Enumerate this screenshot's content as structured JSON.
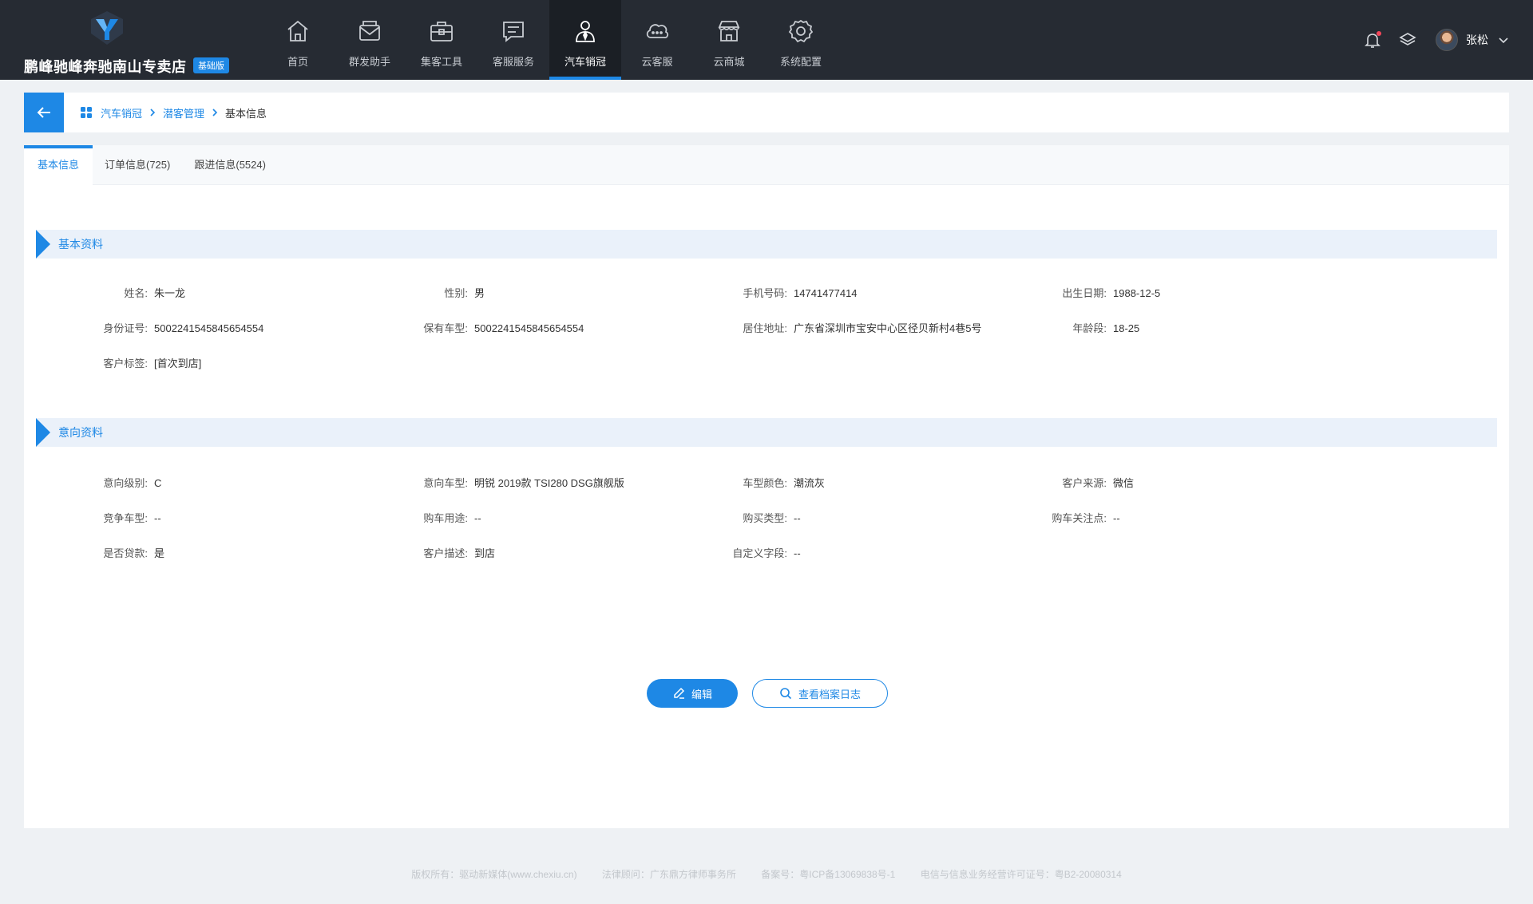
{
  "header": {
    "brand_name": "鹏峰驰峰奔驰南山专卖店",
    "brand_badge": "基础版",
    "nav": [
      {
        "label": "首页",
        "icon": "home-icon"
      },
      {
        "label": "群发助手",
        "icon": "mail-icon"
      },
      {
        "label": "集客工具",
        "icon": "briefcase-icon"
      },
      {
        "label": "客服服务",
        "icon": "message-icon"
      },
      {
        "label": "汽车销冠",
        "icon": "salesperson-icon",
        "active": true
      },
      {
        "label": "云客服",
        "icon": "cloud-chat-icon"
      },
      {
        "label": "云商城",
        "icon": "store-icon"
      },
      {
        "label": "系统配置",
        "icon": "gear-icon"
      }
    ],
    "user_name": "张松"
  },
  "breadcrumb": {
    "items": [
      "汽车销冠",
      "潜客管理"
    ],
    "current": "基本信息"
  },
  "tabs": [
    "基本信息",
    "订单信息(725)",
    "跟进信息(5524)"
  ],
  "sections": {
    "basic": {
      "title": "基本资料",
      "fields": [
        {
          "label": "姓名:",
          "value": "朱一龙"
        },
        {
          "label": "性别:",
          "value": "男"
        },
        {
          "label": "手机号码:",
          "value": "14741477414"
        },
        {
          "label": "出生日期:",
          "value": "1988-12-5"
        },
        {
          "label": "身份证号:",
          "value": "5002241545845654554"
        },
        {
          "label": "保有车型:",
          "value": "5002241545845654554"
        },
        {
          "label": "居住地址:",
          "value": "广东省深圳市宝安中心区径贝新村4巷5号"
        },
        {
          "label": "年龄段:",
          "value": "18-25"
        },
        {
          "label": "客户标签:",
          "value": "[首次到店]"
        }
      ]
    },
    "intent": {
      "title": "意向资料",
      "fields": [
        {
          "label": "意向级别:",
          "value": "C"
        },
        {
          "label": "意向车型:",
          "value": "明锐 2019款 TSI280 DSG旗舰版"
        },
        {
          "label": "车型颜色:",
          "value": "潮流灰"
        },
        {
          "label": "客户来源:",
          "value": "微信"
        },
        {
          "label": "竞争车型:",
          "value": "--"
        },
        {
          "label": "购车用途:",
          "value": "--"
        },
        {
          "label": "购买类型:",
          "value": "--"
        },
        {
          "label": "购车关注点:",
          "value": "--"
        },
        {
          "label": "是否贷款:",
          "value": "是"
        },
        {
          "label": "客户描述:",
          "value": "到店"
        },
        {
          "label": "自定义字段:",
          "value": "--"
        }
      ]
    }
  },
  "actions": {
    "edit": "编辑",
    "view_log": "查看档案日志"
  },
  "footer": [
    "版权所有：驱动新媒体(www.chexiu.cn)",
    "法律顾问：广东鼎方律师事务所",
    "备案号：粤ICP备13069838号-1",
    "电信与信息业务经营许可证号：粤B2-20080314"
  ],
  "colors": {
    "accent": "#1e88e5",
    "topbar": "#262b33",
    "notification_dot": "#f5475a"
  }
}
